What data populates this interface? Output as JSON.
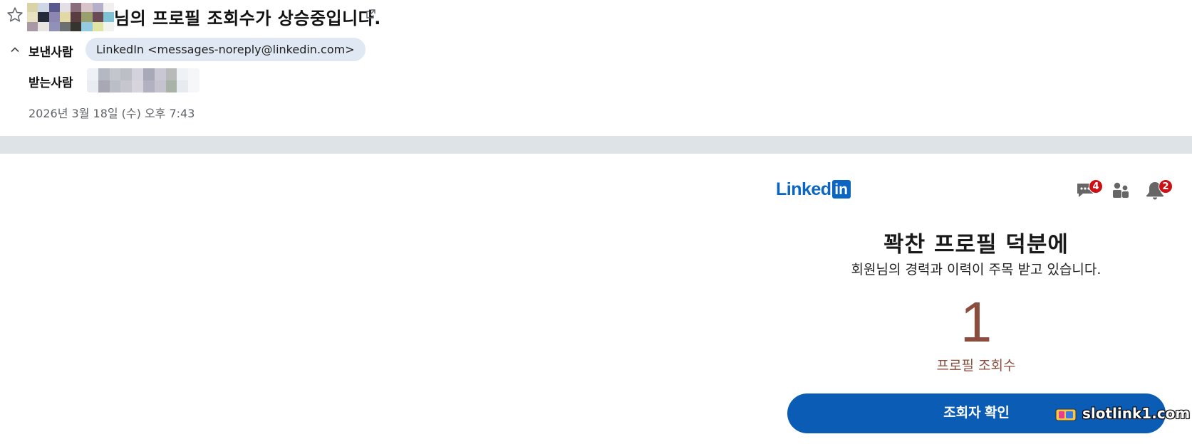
{
  "header": {
    "subject": "님의 프로필 조회수가 상승중입니다.",
    "from_label": "보낸사람",
    "sender": "LinkedIn <messages-noreply@linkedin.com>",
    "to_label": "받는사람",
    "date": "2026년 3월 18일 (수) 오후 7:43"
  },
  "icons": {
    "star": "star-icon",
    "external": "external-link-icon",
    "toggle": "chevron-up-icon",
    "messages": "messages-icon",
    "network": "people-icon",
    "notifications": "bell-icon"
  },
  "linkedin": {
    "logo_text": "Linked",
    "logo_box": "in",
    "messages_badge": "4",
    "notifications_badge": "2",
    "headline": "꽉찬 프로필 덕분에",
    "subline": "회원님의 경력과 이력이 주목 받고 있습니다.",
    "view_count": "1",
    "view_label": "프로필 조회수",
    "cta_label": "조회자 확인"
  },
  "watermark": {
    "text": "slotlink1.com"
  },
  "colors": {
    "brand": "#0a66c2",
    "button": "#0a5cb5",
    "accent": "#8a4d3e",
    "badge": "#cc1016",
    "divider": "#dee3e8",
    "chip": "#dfe8f3"
  }
}
